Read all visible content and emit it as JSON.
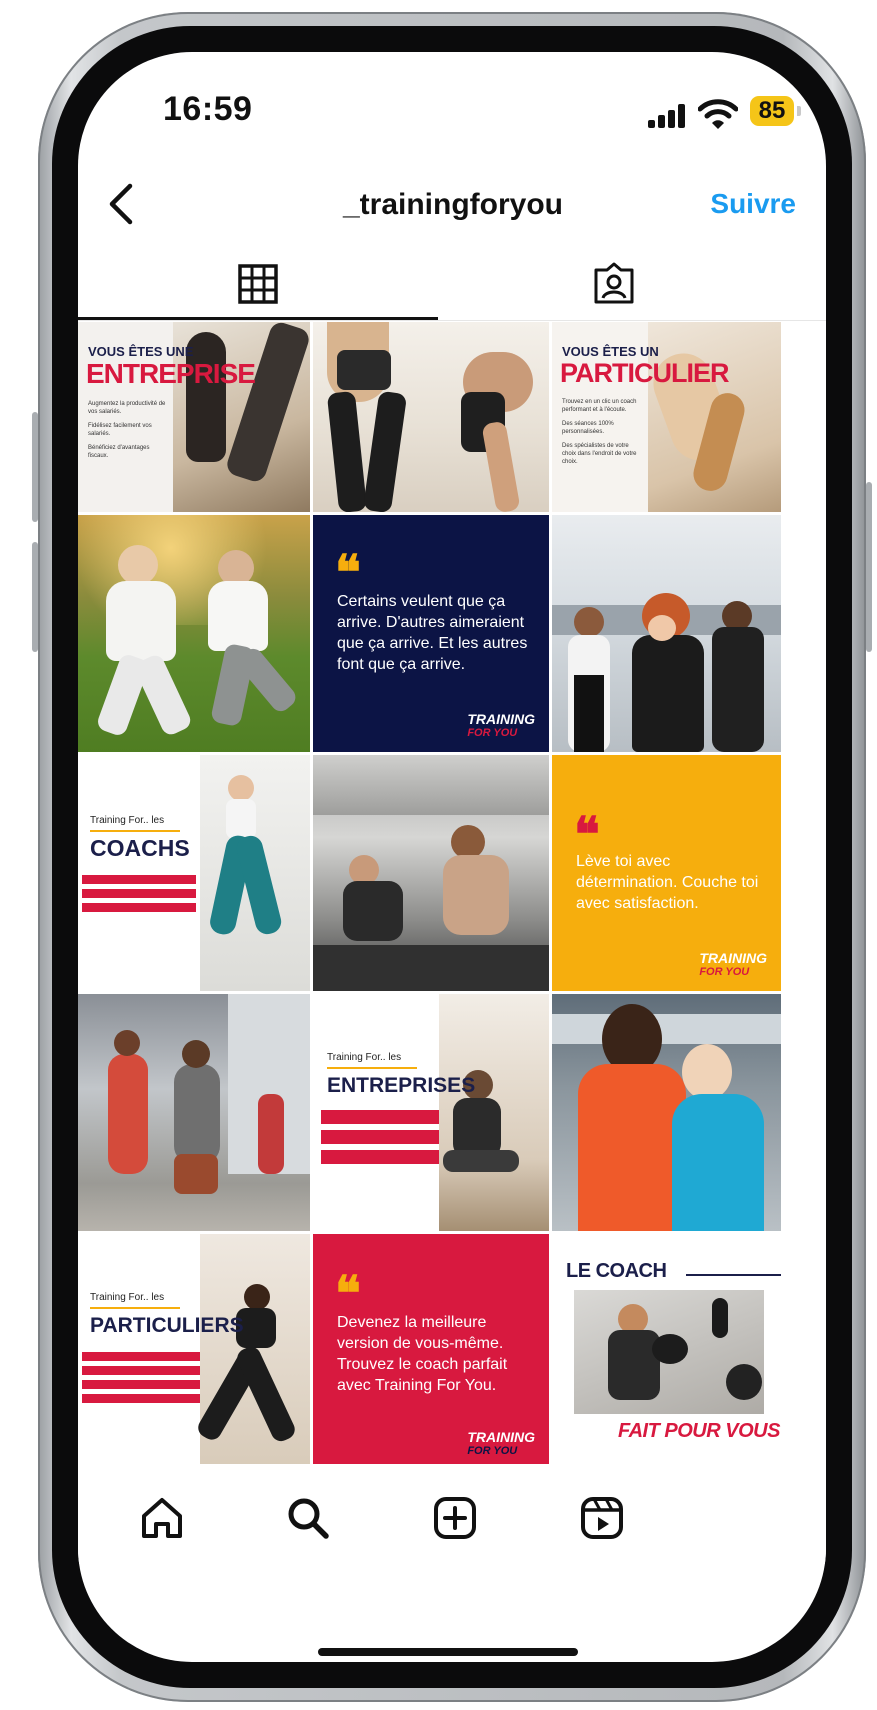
{
  "status": {
    "time": "16:59",
    "battery": "85"
  },
  "header": {
    "username": "_trainingforyou",
    "follow_label": "Suivre"
  },
  "tabs": [
    {
      "name": "grid"
    },
    {
      "name": "tagged"
    }
  ],
  "tiles": {
    "t1": {
      "line1": "VOUS ÊTES UNE",
      "line2": "ENTREPRISE",
      "bullets": [
        "Augmentez la productivité de vos salariés.",
        "Fidélisez facilement vos salariés.",
        "Bénéficiez d'avantages fiscaux."
      ]
    },
    "t3": {
      "line1": "VOUS ÊTES UN",
      "line2": "PARTICULIER",
      "bullets": [
        "Trouvez en un clic un coach performant et à l'écoute.",
        "Des séances 100% personnalisées.",
        "Des spécialistes de votre choix dans l'endroit de votre choix."
      ]
    },
    "t5": {
      "quote": "Certains veulent que ça arrive. D'autres aimeraient que ça arrive. Et les autres font que ça arrive.",
      "brand1": "TRAINING",
      "brand2": "FOR YOU"
    },
    "t7": {
      "small": "Training For.. les",
      "title": "COACHS"
    },
    "t9": {
      "quote": "Lève toi avec détermination. Couche toi avec satisfaction.",
      "brand1": "TRAINING",
      "brand2": "FOR YOU"
    },
    "t11": {
      "small": "Training For.. les",
      "title": "ENTREPRISES"
    },
    "t13": {
      "small": "Training For.. les",
      "title": "PARTICULIERS"
    },
    "t14": {
      "quote": "Devenez la meilleure version de vous-même. Trouvez le coach parfait avec Training For You.",
      "brand1": "TRAINING",
      "brand2": "FOR YOU"
    },
    "t15": {
      "top": "LE COACH",
      "bottom": "FAIT POUR VOUS"
    }
  },
  "colors": {
    "accent_blue": "#1a9bf0",
    "brand_red": "#d8193f",
    "navy": "#0c1445",
    "gold": "#f6ae0d"
  },
  "bottom_nav": [
    {
      "icon": "home-icon"
    },
    {
      "icon": "search-icon"
    },
    {
      "icon": "create-icon"
    },
    {
      "icon": "reels-icon"
    }
  ]
}
